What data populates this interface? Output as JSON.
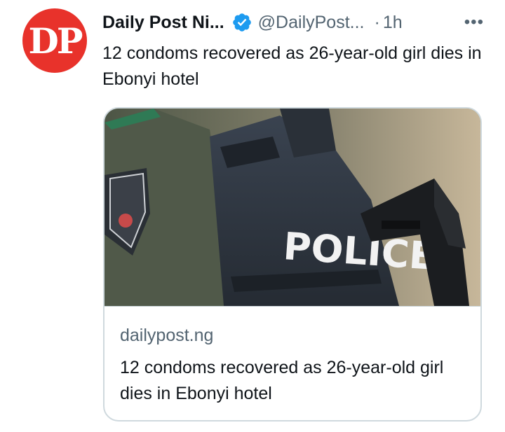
{
  "author": {
    "avatar_text": "DP",
    "display_name": "Daily Post Ni...",
    "handle": "@DailyPost...",
    "separator": "·",
    "time": "1h"
  },
  "more_label": "•••",
  "tweet": {
    "text": "12 condoms recovered as 26-year-old girl dies in Ebonyi hotel"
  },
  "card": {
    "domain": "dailypost.ng",
    "title": "12 condoms recovered as 26-year-old girl dies in Ebonyi hotel",
    "image_text": "POLICE"
  },
  "colors": {
    "avatar_bg": "#e8322b",
    "verified": "#1d9bf0",
    "secondary_text": "#536471",
    "border": "#cfd9de"
  },
  "icons": {
    "verified": "verified-badge-icon",
    "more": "more-horizontal-icon"
  }
}
